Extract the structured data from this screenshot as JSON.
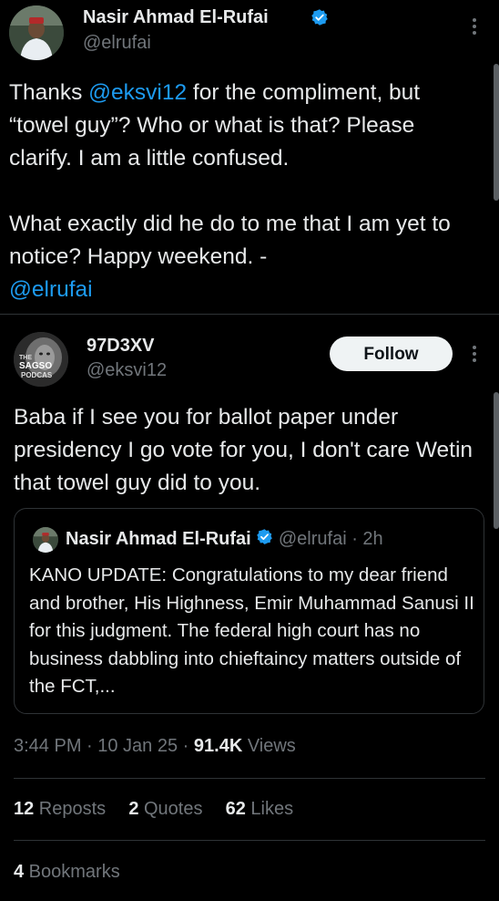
{
  "tweet1": {
    "author_name": "Nasir Ahmad El-Rufai",
    "author_handle": "@elrufai",
    "text_p1_a": "Thanks ",
    "text_p1_mention": "@eksvi12",
    "text_p1_b": " for the compliment, but “towel guy”? Who or what is that? Please clarify. I am a little confused.",
    "text_p2": "What exactly did he do to me that I am yet to notice? Happy weekend. -",
    "text_p2_mention": "@elrufai"
  },
  "tweet2": {
    "author_name": "97D3XV",
    "author_handle": "@eksvi12",
    "follow_label": "Follow",
    "avatar_text_1": "THE",
    "avatar_text_2": "SAGSO",
    "avatar_text_3": "PODCAS",
    "text": "Baba if I see you for ballot paper under presidency I go vote for you, I don't care Wetin that towel guy did to you.",
    "quote": {
      "author_name": "Nasir Ahmad El-Rufai",
      "author_handle": "@elrufai",
      "time": "· 2h",
      "text": "KANO UPDATE: Congratulations to my dear friend and brother, His Highness, Emir Muhammad Sanusi II for this judgment. The federal high court has no business dabbling into chieftaincy matters outside of the FCT,..."
    },
    "timestamp": "3:44 PM · 10 Jan 25 · ",
    "views_count": "91.4K",
    "views_label": " Views",
    "reposts_count": "12",
    "reposts_label": " Reposts",
    "quotes_count": "2",
    "quotes_label": " Quotes",
    "likes_count": "62",
    "likes_label": " Likes",
    "bookmarks_count": "4",
    "bookmarks_label": " Bookmarks"
  },
  "colors": {
    "background": "#000000",
    "text": "#e7e9ea",
    "secondary": "#71767b",
    "accent": "#1d9bf0",
    "divider": "#2f3336"
  },
  "icons": [
    "verified-badge-icon",
    "more-options-icon"
  ]
}
